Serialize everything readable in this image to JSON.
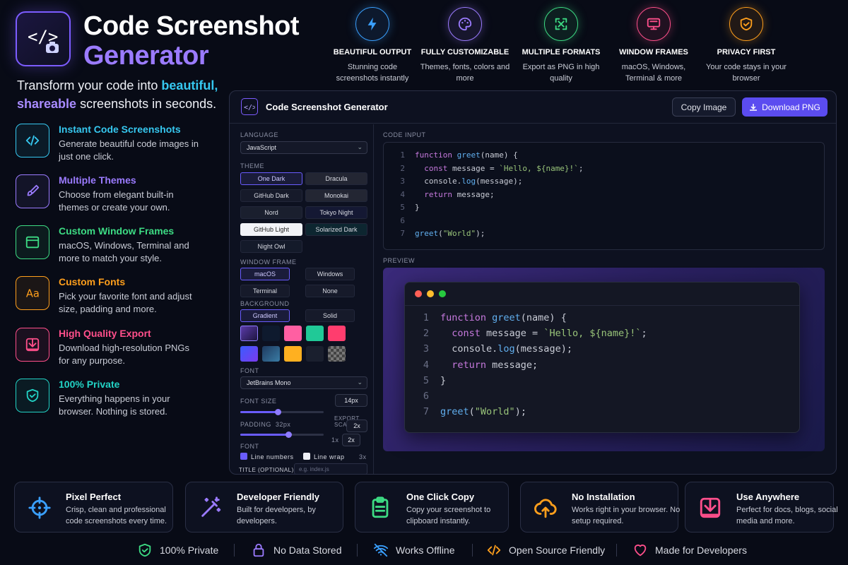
{
  "header": {
    "title_line1": "Code Screenshot",
    "title_line2": "Generator",
    "tagline_pre": "Transform your code into ",
    "tagline_hl1": "beautiful,",
    "tagline_hl2": "shareable",
    "tagline_post": " screenshots in seconds."
  },
  "features": [
    {
      "title": "Instant Code Screenshots",
      "desc": "Generate beautiful code images in just one click.",
      "icon": "code-icon",
      "color": "#36c8f0"
    },
    {
      "title": "Multiple Themes",
      "desc": "Choose from elegant built-in themes or create your own.",
      "icon": "brush-icon",
      "color": "#9b7bff"
    },
    {
      "title": "Custom Window Frames",
      "desc": "macOS, Windows, Terminal and more to match your style.",
      "icon": "window-icon",
      "color": "#3ddc84"
    },
    {
      "title": "Custom Fonts",
      "desc": "Pick your favorite font and adjust size, padding and more.",
      "icon": "font-icon",
      "color": "#ff9f1c"
    },
    {
      "title": "High Quality Export",
      "desc": "Download high-resolution PNGs for any purpose.",
      "icon": "download-icon",
      "color": "#ff4f8b"
    },
    {
      "title": "100% Private",
      "desc": "Everything happens in your browser. Nothing is stored.",
      "icon": "shield-icon",
      "color": "#22d3c5"
    }
  ],
  "top_features": [
    {
      "title": "BEAUTIFUL OUTPUT",
      "desc": "Stunning code screenshots instantly",
      "icon": "bolt-icon",
      "color": "#3aa0ff"
    },
    {
      "title": "FULLY CUSTOMIZABLE",
      "desc": "Themes, fonts, colors and more",
      "icon": "palette-icon",
      "color": "#9b7bff"
    },
    {
      "title": "MULTIPLE FORMATS",
      "desc": "Export as PNG in high quality",
      "icon": "expand-icon",
      "color": "#3ddc84"
    },
    {
      "title": "WINDOW FRAMES",
      "desc": "macOS, Windows, Terminal & more",
      "icon": "monitor-icon",
      "color": "#ff4f8b"
    },
    {
      "title": "PRIVACY FIRST",
      "desc": "Your code stays in your browser",
      "icon": "shield-icon",
      "color": "#ff9f1c"
    }
  ],
  "app": {
    "title": "Code Screenshot Generator",
    "copy_label": "Copy Image",
    "download_label": "Download PNG",
    "language_label": "LANGUAGE",
    "language_value": "JavaScript",
    "theme_label": "THEME",
    "themes": [
      "One Dark",
      "Dracula",
      "GitHub Dark",
      "Monokai",
      "Nord",
      "Tokyo Night",
      "GitHub Light",
      "Solarized Dark",
      "Night Owl"
    ],
    "selected_theme": "One Dark",
    "frame_label": "WINDOW FRAME",
    "frames": [
      "macOS",
      "Windows",
      "Terminal",
      "None"
    ],
    "selected_frame": "macOS",
    "background_label": "BACKGROUND",
    "bg_modes": [
      "Gradient",
      "Solid"
    ],
    "font_label": "FONT",
    "font_value": "JetBrains Mono",
    "font_size_label": "FONT SIZE",
    "font_size_value": "14px",
    "font_size_level": 0.45,
    "padding_label": "PADDING",
    "padding_value": "32px",
    "padding_level": 0.58,
    "export_label": "EXPORT SCALE",
    "export_value": "2x",
    "export_value2": "2x",
    "scale_1x": "1x",
    "scale_3x": "3x",
    "font_label2": "FONT",
    "line_numbers_label": "Line numbers",
    "line_wrap_label": "Line wrap",
    "title_label": "TITLE (OPTIONAL)",
    "title_placeholder": "e.g. index.js",
    "code_input_label": "CODE INPUT",
    "preview_label": "PREVIEW",
    "swatch_colors": [
      "#3a2a7a",
      "#0e1a2e",
      "#ff5fa2",
      "#20c997",
      "#ff3d6e",
      "#5b4cf0",
      "#1e3a5f",
      "#ffb020",
      "#1a1f2e",
      "#888888"
    ]
  },
  "code": [
    {
      "n": "1",
      "parts": [
        [
          "kw",
          "function "
        ],
        [
          "fn",
          "greet"
        ],
        [
          "pl",
          "(name) {"
        ]
      ]
    },
    {
      "n": "2",
      "parts": [
        [
          "kw",
          "  const "
        ],
        [
          "pl",
          "message = "
        ],
        [
          "st",
          "`Hello, ${name}!`"
        ],
        [
          "pl",
          ";"
        ]
      ]
    },
    {
      "n": "3",
      "parts": [
        [
          "pl",
          "  console."
        ],
        [
          "fn",
          "log"
        ],
        [
          "pl",
          "(message);"
        ]
      ]
    },
    {
      "n": "4",
      "parts": [
        [
          "kw",
          "  return "
        ],
        [
          "pl",
          "message;"
        ]
      ]
    },
    {
      "n": "5",
      "parts": [
        [
          "pl",
          "}"
        ]
      ]
    },
    {
      "n": "6",
      "parts": []
    },
    {
      "n": "7",
      "parts": [
        [
          "fn",
          "greet"
        ],
        [
          "pl",
          "("
        ],
        [
          "st",
          "\"World\""
        ],
        [
          "pl",
          ");"
        ]
      ]
    }
  ],
  "cards": [
    {
      "title": "Pixel Perfect",
      "desc": "Crisp, clean and professional code screenshots every time.",
      "icon": "crosshair-icon",
      "color": "#3aa0ff"
    },
    {
      "title": "Developer Friendly",
      "desc": "Built for developers, by developers.",
      "icon": "magic-wand-icon",
      "color": "#9b7bff"
    },
    {
      "title": "One Click Copy",
      "desc": "Copy your screenshot to clipboard instantly.",
      "icon": "clipboard-icon",
      "color": "#3ddc84"
    },
    {
      "title": "No Installation",
      "desc": "Works right in your browser. No setup required.",
      "icon": "cloud-upload-icon",
      "color": "#ff9f1c"
    },
    {
      "title": "Use Anywhere",
      "desc": "Perfect for docs, blogs, social media and more.",
      "icon": "download-icon",
      "color": "#ff4f8b"
    }
  ],
  "bottom_items": [
    {
      "label": "100% Private",
      "icon": "shield-check-icon",
      "color": "#3ddc84"
    },
    {
      "label": "No Data Stored",
      "icon": "lock-icon",
      "color": "#9b7bff"
    },
    {
      "label": "Works Offline",
      "icon": "wifi-off-icon",
      "color": "#3aa0ff"
    },
    {
      "label": "Open Source Friendly",
      "icon": "code-icon",
      "color": "#ff9f1c"
    },
    {
      "label": "Made for Developers",
      "icon": "heart-icon",
      "color": "#ff4f8b"
    }
  ]
}
